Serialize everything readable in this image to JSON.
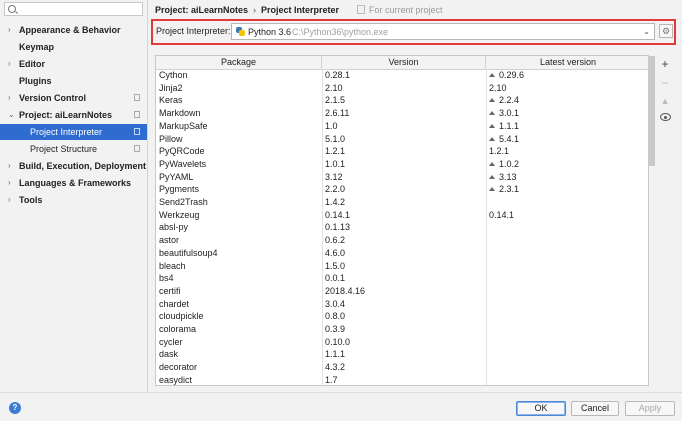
{
  "sidebar": {
    "search_placeholder": "",
    "items": [
      {
        "label": "Appearance & Behavior",
        "chevron": "›",
        "copy_icon": false
      },
      {
        "label": "Keymap",
        "chevron": "",
        "copy_icon": false
      },
      {
        "label": "Editor",
        "chevron": "›",
        "copy_icon": false
      },
      {
        "label": "Plugins",
        "chevron": "",
        "copy_icon": false
      },
      {
        "label": "Version Control",
        "chevron": "›",
        "copy_icon": true
      },
      {
        "label": "Project: aiLearnNotes",
        "chevron": "⌄",
        "copy_icon": true
      },
      {
        "label": "Project Interpreter",
        "chevron": "",
        "copy_icon": true,
        "selected": true
      },
      {
        "label": "Project Structure",
        "chevron": "",
        "copy_icon": true
      },
      {
        "label": "Build, Execution, Deployment",
        "chevron": "›",
        "copy_icon": false
      },
      {
        "label": "Languages & Frameworks",
        "chevron": "›",
        "copy_icon": false
      },
      {
        "label": "Tools",
        "chevron": "›",
        "copy_icon": false
      }
    ]
  },
  "breadcrumb": {
    "project": "Project: aiLearnNotes",
    "separator": "›",
    "page": "Project Interpreter"
  },
  "for_current_project": "For current project",
  "interpreter": {
    "label": "Project Interpreter:",
    "name": "Python 3.6",
    "path": "C:\\Python36\\python.exe",
    "arrow": "⌄",
    "gear": "⚙"
  },
  "packages": {
    "headers": {
      "package": "Package",
      "version": "Version",
      "latest": "Latest version"
    },
    "rows": [
      {
        "package": "Cython",
        "version": "0.28.1",
        "latest": "0.29.6",
        "upgrade": true
      },
      {
        "package": "Jinja2",
        "version": "2.10",
        "latest": "2.10",
        "upgrade": false
      },
      {
        "package": "Keras",
        "version": "2.1.5",
        "latest": "2.2.4",
        "upgrade": true
      },
      {
        "package": "Markdown",
        "version": "2.6.11",
        "latest": "3.0.1",
        "upgrade": true
      },
      {
        "package": "MarkupSafe",
        "version": "1.0",
        "latest": "1.1.1",
        "upgrade": true
      },
      {
        "package": "Pillow",
        "version": "5.1.0",
        "latest": "5.4.1",
        "upgrade": true
      },
      {
        "package": "PyQRCode",
        "version": "1.2.1",
        "latest": "1.2.1",
        "upgrade": false
      },
      {
        "package": "PyWavelets",
        "version": "1.0.1",
        "latest": "1.0.2",
        "upgrade": true
      },
      {
        "package": "PyYAML",
        "version": "3.12",
        "latest": "3.13",
        "upgrade": true
      },
      {
        "package": "Pygments",
        "version": "2.2.0",
        "latest": "2.3.1",
        "upgrade": true
      },
      {
        "package": "Send2Trash",
        "version": "1.4.2",
        "latest": "",
        "upgrade": false
      },
      {
        "package": "Werkzeug",
        "version": "0.14.1",
        "latest": "0.14.1",
        "upgrade": false
      },
      {
        "package": "absl-py",
        "version": "0.1.13",
        "latest": "",
        "upgrade": false
      },
      {
        "package": "astor",
        "version": "0.6.2",
        "latest": "",
        "upgrade": false
      },
      {
        "package": "beautifulsoup4",
        "version": "4.6.0",
        "latest": "",
        "upgrade": false
      },
      {
        "package": "bleach",
        "version": "1.5.0",
        "latest": "",
        "upgrade": false
      },
      {
        "package": "bs4",
        "version": "0.0.1",
        "latest": "",
        "upgrade": false
      },
      {
        "package": "certifi",
        "version": "2018.4.16",
        "latest": "",
        "upgrade": false
      },
      {
        "package": "chardet",
        "version": "3.0.4",
        "latest": "",
        "upgrade": false
      },
      {
        "package": "cloudpickle",
        "version": "0.8.0",
        "latest": "",
        "upgrade": false
      },
      {
        "package": "colorama",
        "version": "0.3.9",
        "latest": "",
        "upgrade": false
      },
      {
        "package": "cycler",
        "version": "0.10.0",
        "latest": "",
        "upgrade": false
      },
      {
        "package": "dask",
        "version": "1.1.1",
        "latest": "",
        "upgrade": false
      },
      {
        "package": "decorator",
        "version": "4.3.2",
        "latest": "",
        "upgrade": false
      },
      {
        "package": "easydict",
        "version": "1.7",
        "latest": "",
        "upgrade": false
      }
    ]
  },
  "side_actions": {
    "add": "+",
    "remove": "−",
    "upgrade": "▲",
    "show_early": "eye-icon"
  },
  "footer": {
    "help": "?",
    "ok": "OK",
    "cancel": "Cancel",
    "apply": "Apply"
  },
  "colors": {
    "selection": "#2f6ccf",
    "highlight_border": "#e03a3a",
    "help": "#3a7cd4"
  }
}
